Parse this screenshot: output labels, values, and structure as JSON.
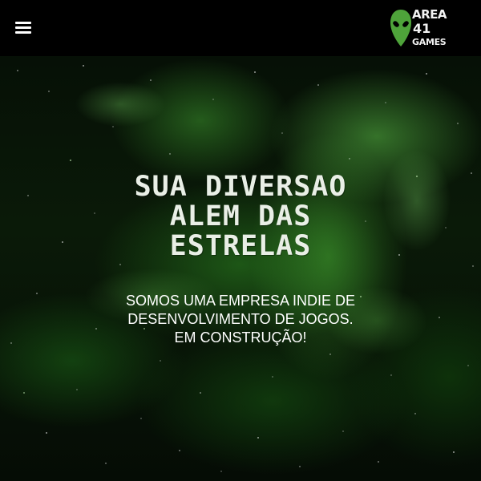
{
  "header": {
    "menu_icon": "hamburger-menu-icon",
    "logo": {
      "icon": "alien-head-icon",
      "line1": "AREA",
      "line2": "41",
      "line3": "GAMES"
    },
    "colors": {
      "background": "#000000",
      "alien": "#4ea33a"
    }
  },
  "hero": {
    "title_lines": [
      "SUA DIVERSAO",
      "ALEM DAS",
      "ESTRELAS"
    ],
    "subtitle_lines": [
      "SOMOS UMA EMPRESA INDIE DE",
      "DESENVOLVIMENTO DE JOGOS.",
      "EM CONSTRUÇÃO!"
    ],
    "colors": {
      "nebula": "#3f9a2e",
      "text": "#ffffff"
    }
  }
}
